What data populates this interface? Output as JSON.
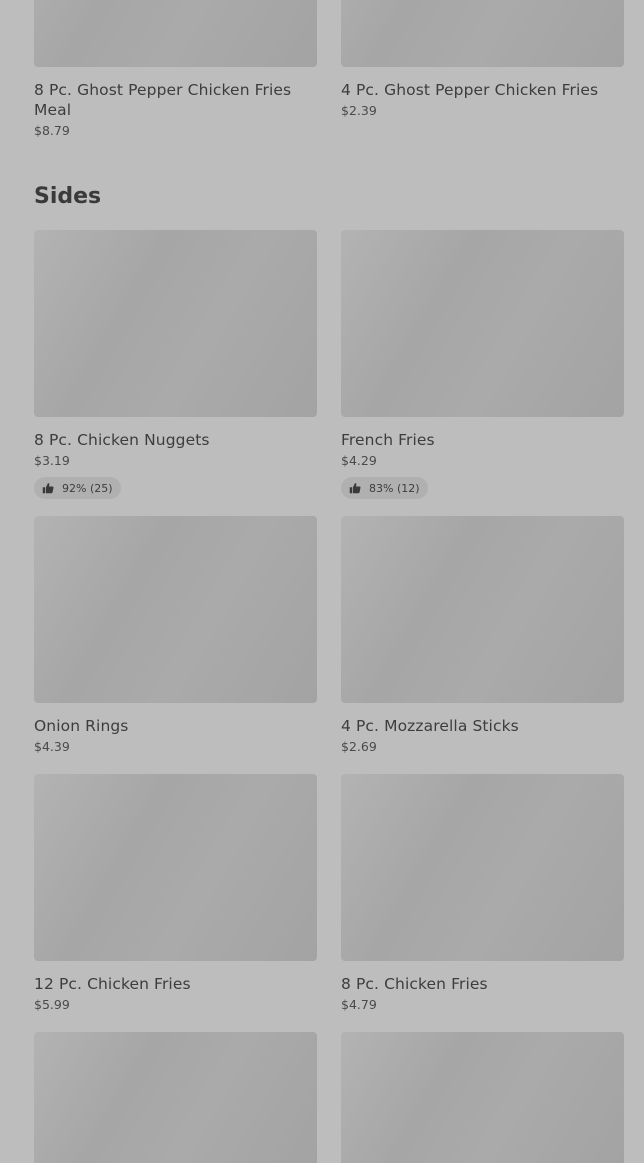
{
  "top_items": [
    {
      "title": "8 Pc. Ghost Pepper Chicken Fries Meal",
      "price": "$8.79"
    },
    {
      "title": "4 Pc. Ghost Pepper Chicken Fries",
      "price": "$2.39"
    }
  ],
  "sides": {
    "heading": "Sides",
    "items": [
      {
        "title": "8 Pc. Chicken Nuggets",
        "price": "$3.19",
        "rating": "92% (25)"
      },
      {
        "title": "French Fries",
        "price": "$4.29",
        "rating": "83% (12)"
      },
      {
        "title": "Onion Rings",
        "price": "$4.39"
      },
      {
        "title": "4 Pc. Mozzarella Sticks",
        "price": "$2.69"
      },
      {
        "title": "12 Pc. Chicken Fries",
        "price": "$5.99"
      },
      {
        "title": "8 Pc. Chicken Fries",
        "price": "$4.79"
      }
    ]
  },
  "icons": {
    "rating": "thumbs-up-icon"
  }
}
